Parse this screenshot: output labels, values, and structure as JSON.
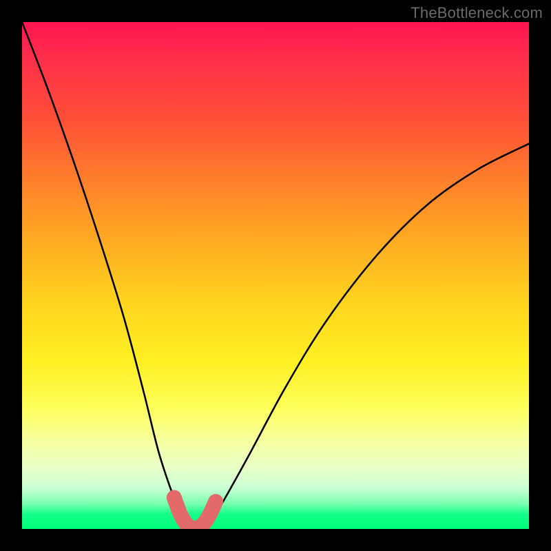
{
  "watermark": "TheBottleneck.com",
  "chart_data": {
    "type": "line",
    "title": "",
    "xlabel": "",
    "ylabel": "",
    "xlim": [
      0,
      100
    ],
    "ylim": [
      0,
      100
    ],
    "grid": false,
    "series": [
      {
        "name": "bottleneck-curve",
        "x": [
          0,
          5,
          10,
          15,
          20,
          24,
          27,
          30,
          32,
          33.5,
          35,
          37,
          40,
          45,
          52,
          60,
          70,
          80,
          90,
          100
        ],
        "y": [
          100,
          87,
          73,
          58,
          42,
          27,
          15,
          6,
          1,
          0,
          0,
          1,
          6,
          15,
          28,
          41,
          54,
          64,
          71,
          76
        ]
      }
    ],
    "marker_segment": {
      "name": "highlighted-minimum",
      "color": "#e36a6a",
      "x": [
        30,
        31.2,
        32.4,
        33.5,
        34.6,
        35.8,
        37,
        38.2
      ],
      "y": [
        6.2,
        3.0,
        1.0,
        0.2,
        0.2,
        1.0,
        2.8,
        5.4
      ]
    }
  }
}
